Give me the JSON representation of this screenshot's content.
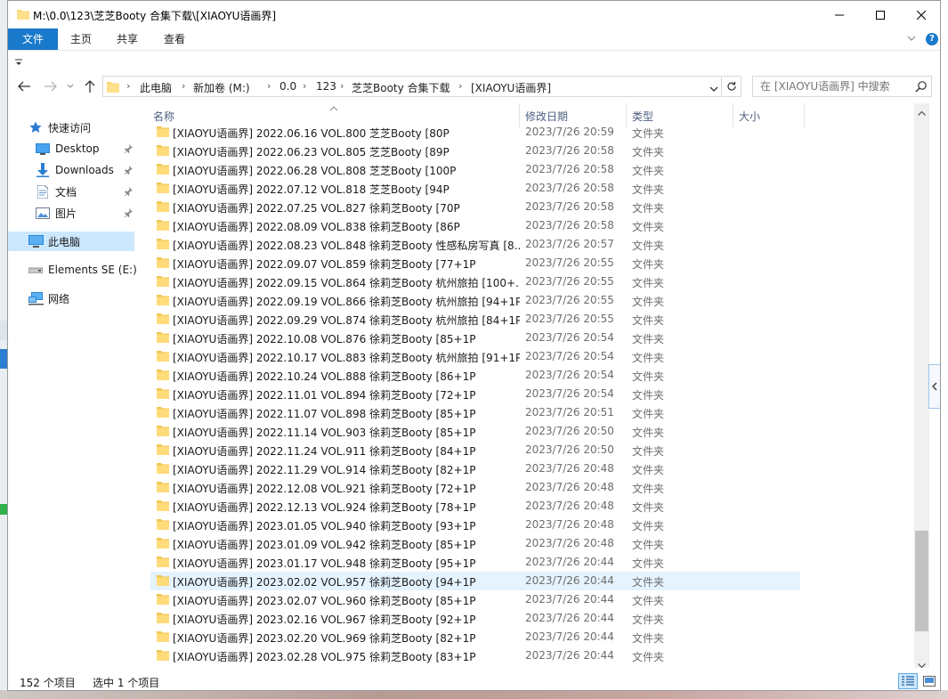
{
  "window": {
    "title": "M:\\0.0\\123\\芝芝Booty 合集下载\\[XIAOYU语画界]"
  },
  "ribbon": {
    "file_tab": "文件",
    "tabs": [
      "主页",
      "共享",
      "查看"
    ]
  },
  "address": {
    "crumbs": [
      "此电脑",
      "新加卷 (M:)",
      "0.0",
      "123",
      "芝芝Booty 合集下载",
      "[XIAOYU语画界]"
    ]
  },
  "search": {
    "placeholder": "在 [XIAOYU语画界] 中搜索"
  },
  "navpane": {
    "quick_access": "快速访问",
    "desktop": "Desktop",
    "downloads": "Downloads",
    "documents": "文档",
    "pictures": "图片",
    "this_pc": "此电脑",
    "drive": "Elements SE (E:)",
    "network": "网络"
  },
  "columns": {
    "name": "名称",
    "date": "修改日期",
    "type": "类型",
    "size": "大小"
  },
  "rows": [
    {
      "name": "[XIAOYU语画界] 2022.06.16 VOL.800 芝芝Booty [80P",
      "date": "2023/7/26 20:59",
      "type": "文件夹"
    },
    {
      "name": "[XIAOYU语画界] 2022.06.23 VOL.805 芝芝Booty [89P",
      "date": "2023/7/26 20:58",
      "type": "文件夹"
    },
    {
      "name": "[XIAOYU语画界] 2022.06.28 VOL.808 芝芝Booty [100P",
      "date": "2023/7/26 20:58",
      "type": "文件夹"
    },
    {
      "name": "[XIAOYU语画界] 2022.07.12 VOL.818 芝芝Booty [94P",
      "date": "2023/7/26 20:58",
      "type": "文件夹"
    },
    {
      "name": "[XIAOYU语画界] 2022.07.25 VOL.827 徐莉芝Booty [70P",
      "date": "2023/7/26 20:58",
      "type": "文件夹"
    },
    {
      "name": "[XIAOYU语画界] 2022.08.09 VOL.838 徐莉芝Booty [86P",
      "date": "2023/7/26 20:58",
      "type": "文件夹"
    },
    {
      "name": "[XIAOYU语画界] 2022.08.23 VOL.848 徐莉芝Booty 性感私房写真 [8...",
      "date": "2023/7/26 20:57",
      "type": "文件夹"
    },
    {
      "name": "[XIAOYU语画界] 2022.09.07 VOL.859 徐莉芝Booty [77+1P",
      "date": "2023/7/26 20:55",
      "type": "文件夹"
    },
    {
      "name": "[XIAOYU语画界] 2022.09.15 VOL.864 徐莉芝Booty 杭州旅拍 [100+...",
      "date": "2023/7/26 20:55",
      "type": "文件夹"
    },
    {
      "name": "[XIAOYU语画界] 2022.09.19 VOL.866 徐莉芝Booty 杭州旅拍 [94+1P",
      "date": "2023/7/26 20:55",
      "type": "文件夹"
    },
    {
      "name": "[XIAOYU语画界] 2022.09.29 VOL.874 徐莉芝Booty 杭州旅拍 [84+1P",
      "date": "2023/7/26 20:55",
      "type": "文件夹"
    },
    {
      "name": "[XIAOYU语画界] 2022.10.08 VOL.876 徐莉芝Booty [85+1P",
      "date": "2023/7/26 20:54",
      "type": "文件夹"
    },
    {
      "name": "[XIAOYU语画界] 2022.10.17 VOL.883 徐莉芝Booty 杭州旅拍 [91+1P",
      "date": "2023/7/26 20:54",
      "type": "文件夹"
    },
    {
      "name": "[XIAOYU语画界] 2022.10.24 VOL.888 徐莉芝Booty [86+1P",
      "date": "2023/7/26 20:54",
      "type": "文件夹"
    },
    {
      "name": "[XIAOYU语画界] 2022.11.01 VOL.894 徐莉芝Booty [72+1P",
      "date": "2023/7/26 20:54",
      "type": "文件夹"
    },
    {
      "name": "[XIAOYU语画界] 2022.11.07 VOL.898 徐莉芝Booty [85+1P",
      "date": "2023/7/26 20:51",
      "type": "文件夹"
    },
    {
      "name": "[XIAOYU语画界] 2022.11.14 VOL.903 徐莉芝Booty [85+1P",
      "date": "2023/7/26 20:50",
      "type": "文件夹"
    },
    {
      "name": "[XIAOYU语画界] 2022.11.24 VOL.911 徐莉芝Booty [84+1P",
      "date": "2023/7/26 20:50",
      "type": "文件夹"
    },
    {
      "name": "[XIAOYU语画界] 2022.11.29 VOL.914 徐莉芝Booty [82+1P",
      "date": "2023/7/26 20:48",
      "type": "文件夹"
    },
    {
      "name": "[XIAOYU语画界] 2022.12.08 VOL.921 徐莉芝Booty [72+1P",
      "date": "2023/7/26 20:48",
      "type": "文件夹"
    },
    {
      "name": "[XIAOYU语画界] 2022.12.13 VOL.924 徐莉芝Booty [78+1P",
      "date": "2023/7/26 20:48",
      "type": "文件夹"
    },
    {
      "name": "[XIAOYU语画界] 2023.01.05 VOL.940 徐莉芝Booty [93+1P",
      "date": "2023/7/26 20:48",
      "type": "文件夹"
    },
    {
      "name": "[XIAOYU语画界] 2023.01.09 VOL.942 徐莉芝Booty [85+1P",
      "date": "2023/7/26 20:48",
      "type": "文件夹"
    },
    {
      "name": "[XIAOYU语画界] 2023.01.17 VOL.948 徐莉芝Booty [95+1P",
      "date": "2023/7/26 20:44",
      "type": "文件夹"
    },
    {
      "name": "[XIAOYU语画界] 2023.02.02 VOL.957 徐莉芝Booty [94+1P",
      "date": "2023/7/26 20:44",
      "type": "文件夹",
      "selected": true
    },
    {
      "name": "[XIAOYU语画界] 2023.02.07 VOL.960 徐莉芝Booty [85+1P",
      "date": "2023/7/26 20:44",
      "type": "文件夹"
    },
    {
      "name": "[XIAOYU语画界] 2023.02.16 VOL.967 徐莉芝Booty [92+1P",
      "date": "2023/7/26 20:44",
      "type": "文件夹"
    },
    {
      "name": "[XIAOYU语画界] 2023.02.20 VOL.969 徐莉芝Booty [82+1P",
      "date": "2023/7/26 20:44",
      "type": "文件夹"
    },
    {
      "name": "[XIAOYU语画界] 2023.02.28 VOL.975 徐莉芝Booty [83+1P",
      "date": "2023/7/26 20:44",
      "type": "文件夹"
    }
  ],
  "status": {
    "count": "152 个项目",
    "selection": "选中 1 个项目"
  },
  "colors": {
    "accent": "#1979ca",
    "selected_row": "#e5f3ff",
    "folder": "#f8d775"
  }
}
